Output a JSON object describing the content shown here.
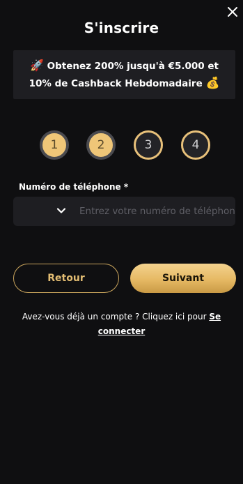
{
  "modal": {
    "title": "S'inscrire",
    "close_icon": "close-icon"
  },
  "promo": {
    "rocket_emoji": "🚀",
    "line1": "Obtenez 200% jusqu'à €5.000 et",
    "line2": "10% de Cashback Hebdomadaire",
    "moneybag_emoji": "💰"
  },
  "steps": [
    {
      "label": "1",
      "state": "completed"
    },
    {
      "label": "2",
      "state": "completed"
    },
    {
      "label": "3",
      "state": "pending"
    },
    {
      "label": "4",
      "state": "pending"
    }
  ],
  "phone": {
    "label": "Numéro de téléphone *",
    "placeholder": "Entrez votre numéro de téléphone",
    "value": "",
    "country_selected": "",
    "dropdown_icon": "chevron-down-icon"
  },
  "buttons": {
    "back_label": "Retour",
    "next_label": "Suivant"
  },
  "login": {
    "prompt": "Avez-vous déjà un compte ? Cliquez ici pour ",
    "link_label": "Se connecter"
  },
  "colors": {
    "background": "#0f0f11",
    "panel": "#1e1e22",
    "gold": "#efc678",
    "gold_border": "#c9a45c"
  }
}
